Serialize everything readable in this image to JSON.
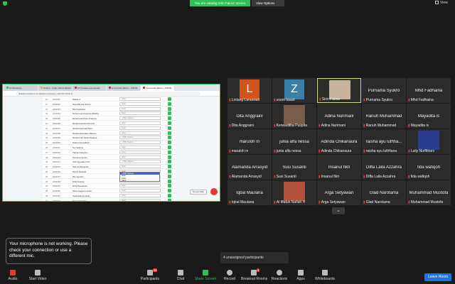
{
  "topbar": {
    "share_banner": "You are viewing Sirin Fairus' screen",
    "view_options": "View Options",
    "view_label": "View"
  },
  "shared_screen": {
    "browser_tabs": [
      "Di WhatsApp",
      "Outline - Kelas Teknik Elektro",
      "STI bahasa perusahaan",
      "Universitas Batam - SIM Bo",
      "Universitas Batam - SIM Bo"
    ],
    "url": "siakad.univbatam.ac.id/adm/c-krs/input_nilai/?AKTKUL-S",
    "rows": [
      {
        "no": "16",
        "nim": "2201001",
        "name": "Mawar A",
        "grade": "Isian"
      },
      {
        "no": "17",
        "nim": "2201002",
        "name": "Mayadita Isis Ifrahim",
        "grade": "Isian"
      },
      {
        "no": "18",
        "nim": "2201003",
        "name": "Mhd Fadhaina",
        "grade": "Isian"
      },
      {
        "no": "19",
        "nim": "2201004",
        "name": "Muhammad Avarinda Alfathra",
        "grade": "Isian"
      },
      {
        "no": "20",
        "nim": "2201005",
        "name": "Muhammad Ilham Pratama",
        "grade": "--Pilih Status--"
      },
      {
        "no": "21",
        "nim": "2201006",
        "name": "Muhammad Mustofa Aris",
        "grade": "Isian"
      },
      {
        "no": "22",
        "nim": "2201007",
        "name": "Muhammad Hadi Mrol",
        "grade": "Isian"
      },
      {
        "no": "23",
        "nim": "2201008",
        "name": "Muhammad Hasiz Wibowo",
        "grade": "Isian"
      },
      {
        "no": "24",
        "nim": "2201009",
        "name": "Muhammad Taufiq Pratama",
        "grade": "--Pilih Status--"
      },
      {
        "no": "25",
        "nim": "2201010",
        "name": "Nadiya Ramadhani",
        "grade": "--Pilih Status--"
      },
      {
        "no": "26",
        "nim": "2201011",
        "name": "Nur Sabrina",
        "grade": "Isian"
      },
      {
        "no": "27",
        "nim": "2201012",
        "name": "Pahrian Nasution",
        "grade": "Isian"
      },
      {
        "no": "28",
        "nim": "2201013",
        "name": "Purnama Syukro",
        "grade": "Isian"
      },
      {
        "no": "29",
        "nim": "2201014",
        "name": "Putri Agusalini Putri",
        "grade": "--Pilih Status--"
      },
      {
        "no": "30",
        "nim": "2201015",
        "name": "Rahma Ratnawati",
        "grade": "Isian"
      },
      {
        "no": "31",
        "nim": "2201016",
        "name": "Ranuh Mustafa",
        "grade": "Isian"
      },
      {
        "no": "32",
        "nim": "2201017",
        "name": "Rini Agustini",
        "grade": "--Pilih Status--"
      },
      {
        "no": "33",
        "nim": "2201018",
        "name": "Rizki Ananda",
        "grade": "--Pilih Status--"
      },
      {
        "no": "34",
        "nim": "2201019",
        "name": "Rizqi Ramadhan",
        "grade": "Isian"
      },
      {
        "no": "35",
        "nim": "2201020",
        "name": "Sinta Anggrek Lestari",
        "grade": "Isian"
      },
      {
        "no": "36",
        "nim": "2201021",
        "name": "Syaifuddin Aprianto",
        "grade": "Isian"
      },
      {
        "no": "37",
        "nim": "2201022",
        "name": "Tasya Salsabila",
        "grade": "Isian"
      }
    ],
    "dropdown_options": [
      "--Pilih Status--",
      "Isian",
      "Hadir",
      "Sakit"
    ],
    "save_button": "Simpan Nilai"
  },
  "tiles": [
    {
      "name": "",
      "label": "Lintang Laraswati",
      "letter": "L",
      "avatar_color": "#d1541f"
    },
    {
      "name": "",
      "label": "zoom baadi",
      "letter": "Z",
      "avatar_color": "#3a7fa6"
    },
    {
      "name": "",
      "label": "Sirin Fairus",
      "photo": true
    },
    {
      "name": "Purnama Syukro",
      "label": "Purnama Syukro"
    },
    {
      "name": "Mhd Fadhaina",
      "label": "Mhd Fadhaina"
    },
    {
      "name": "Dita Anggraini",
      "label": "Dita Anggraini"
    },
    {
      "name": "",
      "label": "Kerwaditha Puspita",
      "photo": true
    },
    {
      "name": "Adina Nurimani",
      "label": "Adina Nurimani"
    },
    {
      "name": "Ranuh Muhammad",
      "label": "Ranuh Muhammad"
    },
    {
      "name": "Mayadita is",
      "label": "Mayadita is"
    },
    {
      "name": "maruloh m",
      "label": "maruloh m"
    },
    {
      "name": "junia alfa nessa",
      "label": "junia alfa nessa"
    },
    {
      "name": "Adinda Chikanaura",
      "label": "Adinda Chikanaura"
    },
    {
      "name": "raisha ayu luthfia...",
      "label": "raisha ayu luthfiana"
    },
    {
      "name": "",
      "label": "Laily Nurfitriani",
      "photo": true
    },
    {
      "name": "Alamanda Arrasyid",
      "label": "Alamanda Arrasyid"
    },
    {
      "name": "Susi Susanti",
      "label": "Susi Susanti"
    },
    {
      "name": "Insanul fikri",
      "label": "Insanul fikri"
    },
    {
      "name": "Diffa Laila Azzahra",
      "label": "Diffa Laila Azzahra"
    },
    {
      "name": "fida wafiqoh",
      "label": "fida wafiqoh"
    },
    {
      "name": "Iqbal Maulana",
      "label": "Iqbal Maulana"
    },
    {
      "name": "",
      "label": "Al Iffatun Nafiah H",
      "photo": true
    },
    {
      "name": "Arga Setyawan",
      "label": "Arga Setyawan"
    },
    {
      "name": "Glad Narotama",
      "label": "Glad Narotama"
    },
    {
      "name": "Muhammad Mustofa",
      "label": "Muhammad Mustofa"
    }
  ],
  "toast": "Your microphone is not working. Please check your connection or use a different mic.",
  "unassigned": "4 unassigned participants",
  "toolbar": {
    "audio": "Audio",
    "video": "Start Video",
    "participants": "Participants",
    "participants_count": "28",
    "chat": "Chat",
    "share": "Share Screen",
    "record": "Record",
    "breakout": "Breakout Rooms",
    "breakout_count": "4",
    "reactions": "Reactions",
    "apps": "Apps",
    "whiteboards": "Whiteboards",
    "leave": "Leave Room"
  }
}
